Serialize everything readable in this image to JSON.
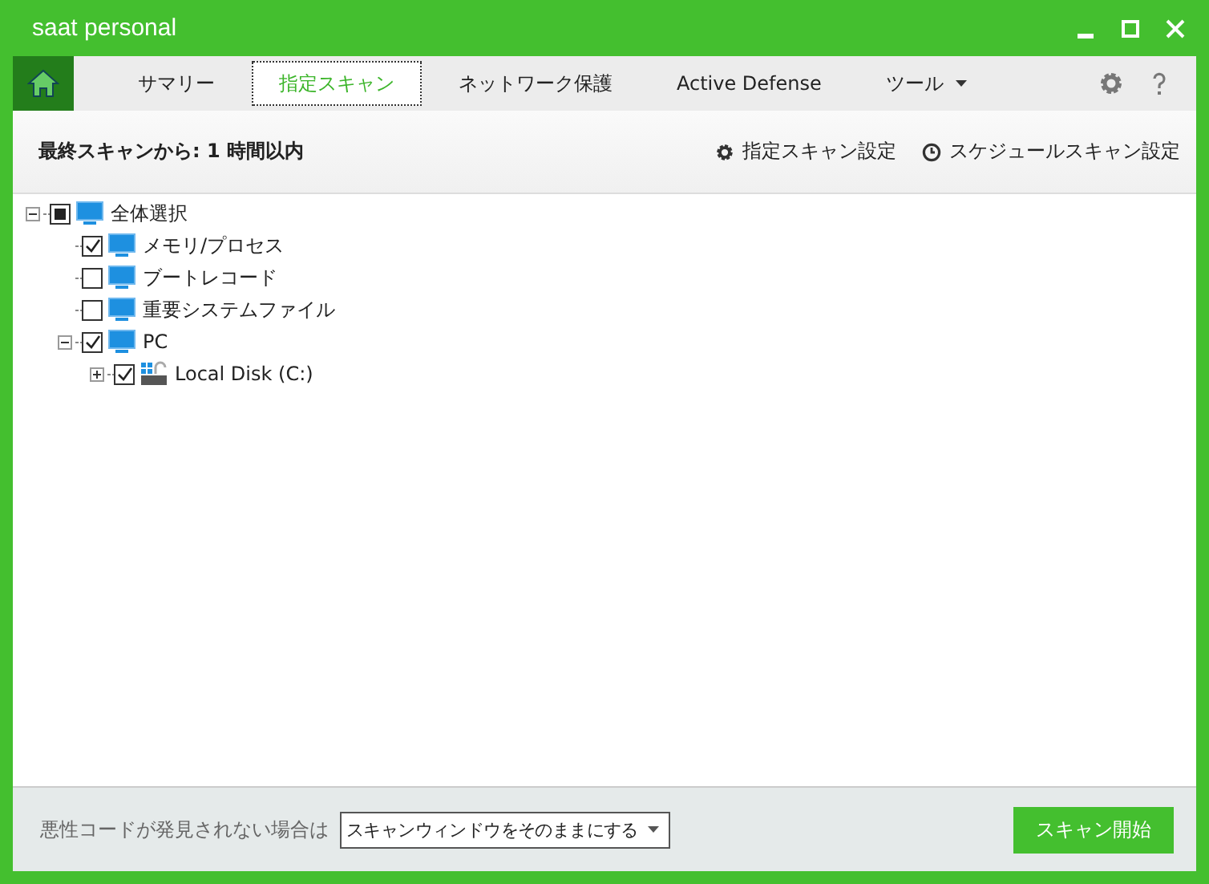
{
  "window": {
    "title": "saat personal"
  },
  "tabs": [
    {
      "label": "サマリー",
      "selected": false,
      "dropdown": false
    },
    {
      "label": "指定スキャン",
      "selected": true,
      "dropdown": false
    },
    {
      "label": "ネットワーク保護",
      "selected": false,
      "dropdown": false
    },
    {
      "label": "Active Defense",
      "selected": false,
      "dropdown": false
    },
    {
      "label": "ツール",
      "selected": false,
      "dropdown": true
    }
  ],
  "info_bar": {
    "last_scan": "最終スキャンから: 1 時間以内",
    "links": [
      {
        "kind": "gear",
        "label": "指定スキャン設定"
      },
      {
        "kind": "clock",
        "label": "スケジュールスキャン設定"
      }
    ]
  },
  "tree": [
    {
      "label": "全体選択",
      "checked": false,
      "indeterminate": true,
      "kind": "monitor",
      "expanded": true,
      "children": [
        {
          "label": "メモリ/プロセス",
          "checked": true,
          "kind": "monitor"
        },
        {
          "label": "ブートレコード",
          "checked": false,
          "kind": "monitor"
        },
        {
          "label": "重要システムファイル",
          "checked": false,
          "kind": "monitor"
        },
        {
          "label": "PC",
          "checked": true,
          "kind": "monitor",
          "expanded": true,
          "children": [
            {
              "label": "Local Disk (C:)",
              "checked": true,
              "kind": "drive",
              "expanded": false
            }
          ]
        }
      ]
    }
  ],
  "footer": {
    "label": "悪性コードが発見されない場合は",
    "dropdown_value": "スキャンウィンドウをそのままにする",
    "button": "スキャン開始"
  }
}
